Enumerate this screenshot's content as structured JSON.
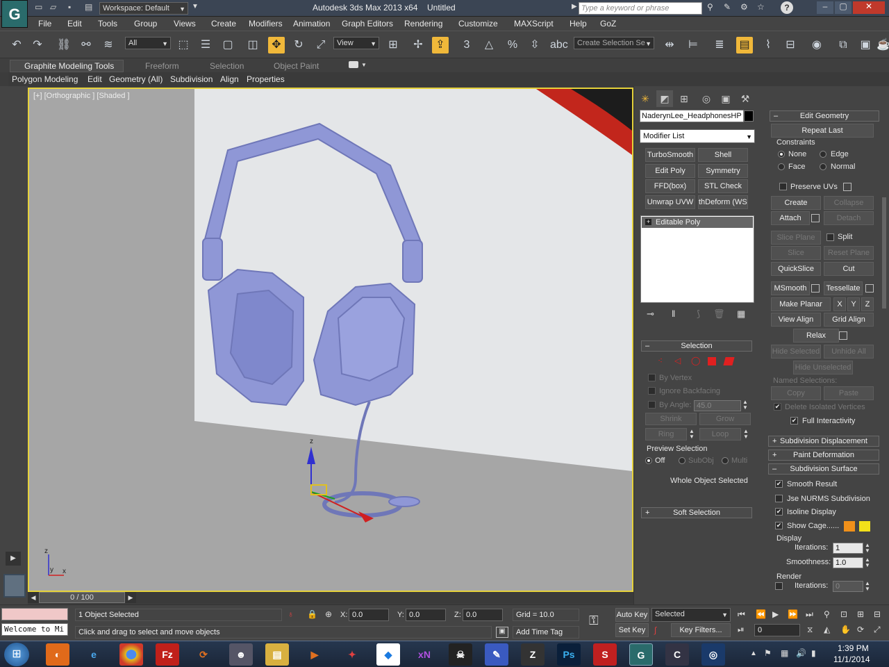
{
  "title": {
    "workspace": "Workspace: Default",
    "app": "Autodesk 3ds Max  2013 x64",
    "doc": "Untitled",
    "search_placeholder": "Type a keyword or phrase"
  },
  "menu": [
    "File",
    "Edit",
    "Tools",
    "Group",
    "Views",
    "Create",
    "Modifiers",
    "Animation",
    "Graph Editors",
    "Rendering",
    "Customize",
    "MAXScript",
    "Help",
    "GoZ"
  ],
  "toolbar": {
    "filter": "All",
    "ref_coord": "View",
    "create_selection_set": "Create Selection Se",
    "snap_label": "3"
  },
  "ribbon": {
    "tabs": [
      "Graphite Modeling Tools",
      "Freeform",
      "Selection",
      "Object Paint"
    ],
    "sub": [
      "Polygon Modeling",
      "Edit",
      "Geometry (All)",
      "Subdivision",
      "Align",
      "Properties"
    ]
  },
  "viewport": {
    "label": "[+] [Orthographic ] [Shaded ]",
    "axis_x": "x",
    "axis_y": "y",
    "axis_z": "z"
  },
  "timebar": {
    "frame": "0 / 100"
  },
  "command": {
    "object_name": "NaderynLee_HeadphonesHP",
    "modifier_list": "Modifier List",
    "mod_buttons": [
      "TurboSmooth",
      "Shell",
      "Edit Poly",
      "Symmetry",
      "FFD(box)",
      "STL Check",
      "Unwrap UVW",
      "thDeform (WSI"
    ],
    "stack_item": "Editable Poly",
    "selection": {
      "title": "Selection",
      "by_vertex": "By Vertex",
      "ignore_backfacing": "Ignore Backfacing",
      "by_angle": "By Angle:",
      "angle_value": "45.0",
      "shrink": "Shrink",
      "grow": "Grow",
      "ring": "Ring",
      "loop": "Loop",
      "preview_title": "Preview Selection",
      "off": "Off",
      "subobj": "SubObj",
      "multi": "Multi",
      "whole": "Whole Object Selected"
    },
    "soft_selection": "Soft Selection"
  },
  "edit_geometry": {
    "title": "Edit Geometry",
    "repeat_last": "Repeat Last",
    "constraints": "Constraints",
    "none": "None",
    "edge": "Edge",
    "face": "Face",
    "normal": "Normal",
    "preserve_uvs": "Preserve UVs",
    "create": "Create",
    "collapse": "Collapse",
    "attach": "Attach",
    "detach": "Detach",
    "slice_plane": "Slice Plane",
    "split": "Split",
    "slice": "Slice",
    "reset_plane": "Reset Plane",
    "quickslice": "QuickSlice",
    "cut": "Cut",
    "msmooth": "MSmooth",
    "tessellate": "Tessellate",
    "make_planar": "Make Planar",
    "x": "X",
    "y": "Y",
    "z": "Z",
    "view_align": "View Align",
    "grid_align": "Grid Align",
    "relax": "Relax",
    "hide_selected": "Hide Selected",
    "unhide_all": "Unhide All",
    "hide_unselected": "Hide Unselected",
    "named_selections": "Named Selections:",
    "copy": "Copy",
    "paste": "Paste",
    "delete_isolated": "Delete Isolated Vertices",
    "full_interactivity": "Full Interactivity"
  },
  "subdiv": {
    "displacement": "Subdivision Displacement",
    "paint_deformation": "Paint Deformation",
    "surface": "Subdivision Surface",
    "smooth_result": "Smooth Result",
    "use_nurms": "Jse NURMS Subdivision",
    "isoline": "Isoline Display",
    "show_cage": "Show Cage......",
    "display": "Display",
    "iterations": "Iterations:",
    "iterations_value": "1",
    "smoothness": "Smoothness:",
    "smoothness_value": "1.0",
    "render": "Render",
    "render_iterations": "Iterations:",
    "render_iterations_value": "0",
    "cage_color_1": "#f0901a",
    "cage_color_2": "#f2e01a"
  },
  "status": {
    "script": "Welcome to Mi",
    "selected": "1 Object Selected",
    "prompt": "Click and drag to select and move objects",
    "x_label": "X:",
    "x": "0.0",
    "y_label": "Y:",
    "y": "0.0",
    "z_label": "Z:",
    "z": "0.0",
    "grid": "Grid = 10.0",
    "add_time_tag": "Add Time Tag",
    "auto_key": "Auto Key",
    "set_key": "Set Key",
    "key_mode": "Selected",
    "key_filters": "Key Filters...",
    "frame": "0"
  },
  "taskbar": {
    "time": "1:39 PM",
    "date": "11/1/2014"
  },
  "colors": {
    "accent": "#f0b83a",
    "viewport_border": "#e6d23a",
    "headphones": "#8f97d6"
  }
}
